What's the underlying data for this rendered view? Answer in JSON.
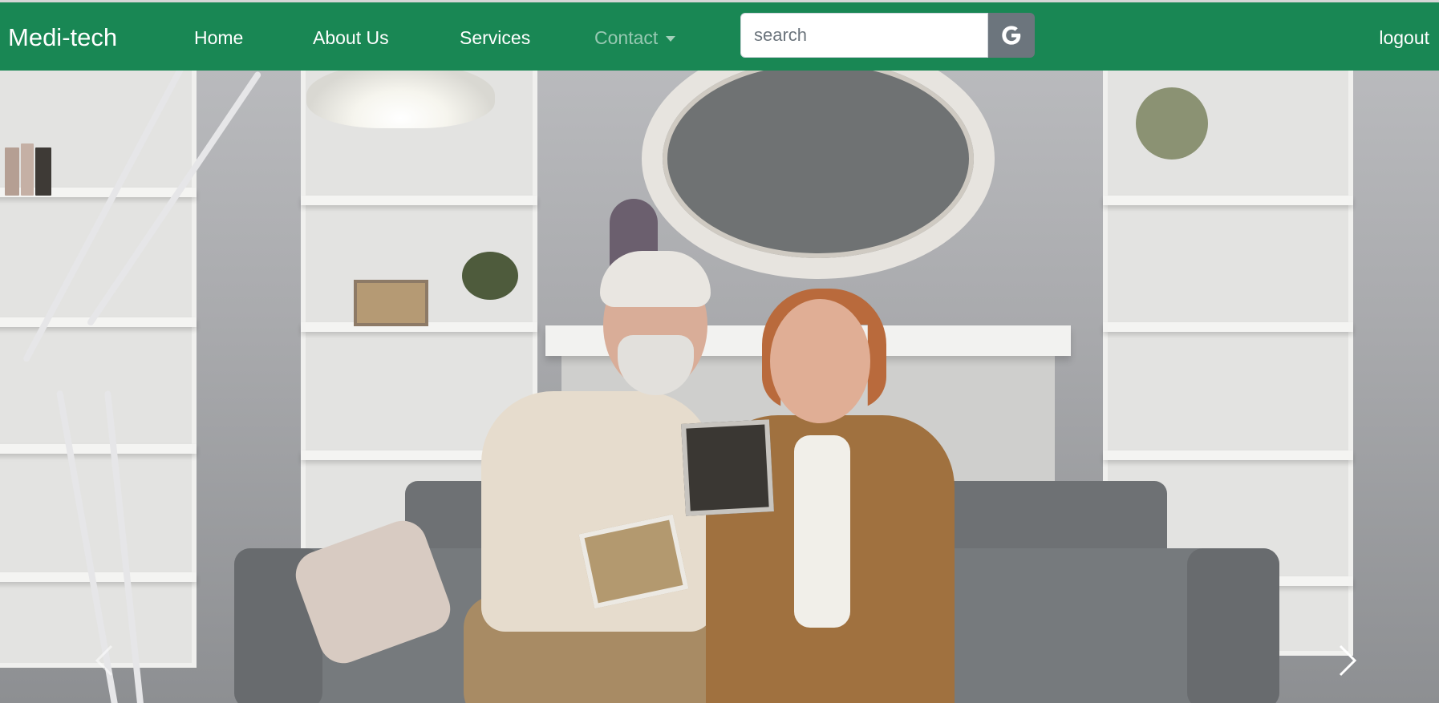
{
  "navbar": {
    "brand": "Medi-tech",
    "links": [
      {
        "label": "Home"
      },
      {
        "label": "About Us"
      },
      {
        "label": "Services"
      },
      {
        "label": "Contact"
      }
    ],
    "search": {
      "placeholder": "search",
      "button_icon": "google-g-icon"
    },
    "logout_label": "logout",
    "colors": {
      "navbar_bg": "#198754",
      "search_button_bg": "#6c757d"
    }
  },
  "hero": {
    "image_description_icon": "hero-photo",
    "controls": {
      "prev_icon": "chevron-left-icon",
      "next_icon": "chevron-right-icon"
    }
  }
}
